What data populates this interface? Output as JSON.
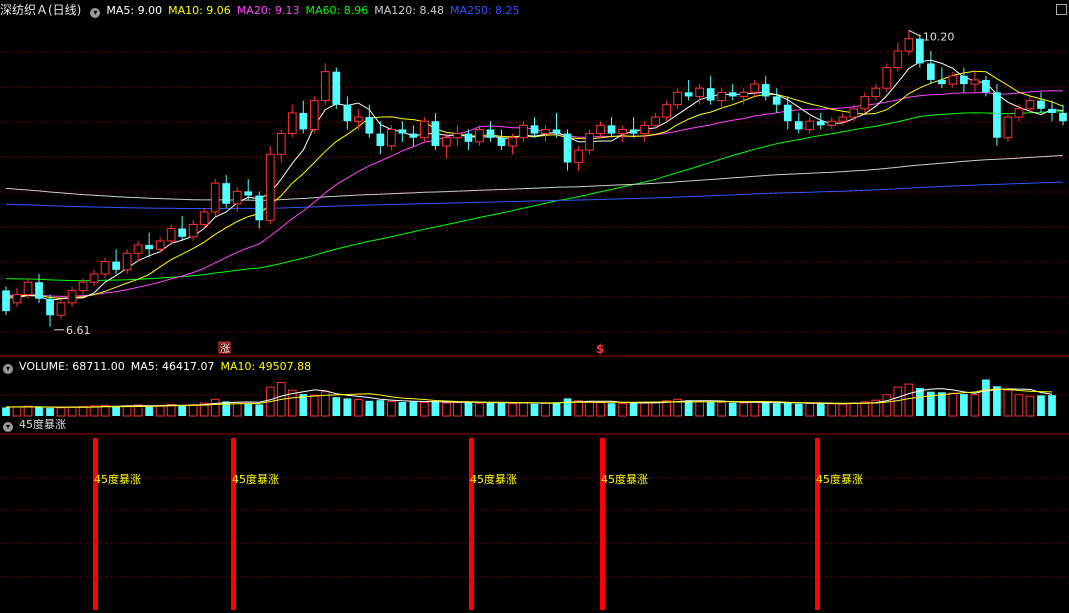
{
  "header": {
    "title": "深纺织Ａ(日线)",
    "indicators": [
      {
        "text": "MA5: 9.00",
        "color": "#ffffff"
      },
      {
        "text": "MA10: 9.06",
        "color": "#ffff00"
      },
      {
        "text": "MA20: 9.13",
        "color": "#ff44ff"
      },
      {
        "text": "MA60: 8.96",
        "color": "#00ff00"
      },
      {
        "text": "MA120: 8.48",
        "color": "#cccccc"
      },
      {
        "text": "MA250: 8.25",
        "color": "#3355ff"
      }
    ]
  },
  "volume_header": {
    "volume": "VOLUME: 68711.00",
    "ma5": "MA5: 46417.07",
    "ma10": "MA10: 49507.88"
  },
  "signal_header": {
    "title": "45度暴涨"
  },
  "annotations": {
    "high_label": "10.20",
    "low_label": "6.61",
    "marker_1": "涨",
    "marker_2": "$"
  },
  "colors": {
    "up": "#ff3232",
    "down": "#54ffff",
    "grid": "#7a0000",
    "ma5": "#ffffff",
    "ma10": "#ffff00",
    "ma20": "#ff44ff",
    "ma60": "#00ff00",
    "ma120": "#cccccc",
    "ma250": "#3355ff",
    "signal": "#ff0000"
  },
  "chart_data": [
    {
      "type": "candlestick",
      "candles": [
        [
          7.05,
          7.1,
          6.8,
          6.75
        ],
        [
          6.9,
          7.08,
          7.0,
          6.85
        ],
        [
          7.0,
          7.2,
          7.15,
          6.95
        ],
        [
          7.15,
          7.25,
          6.95,
          6.9
        ],
        [
          6.95,
          7.0,
          6.75,
          6.61
        ],
        [
          6.75,
          6.95,
          6.9,
          6.7
        ],
        [
          6.9,
          7.1,
          7.05,
          6.85
        ],
        [
          7.05,
          7.2,
          7.15,
          7.0
        ],
        [
          7.15,
          7.3,
          7.25,
          7.1
        ],
        [
          7.25,
          7.45,
          7.4,
          7.2
        ],
        [
          7.4,
          7.55,
          7.3,
          7.25
        ],
        [
          7.3,
          7.55,
          7.5,
          7.25
        ],
        [
          7.5,
          7.65,
          7.6,
          7.4
        ],
        [
          7.6,
          7.75,
          7.55,
          7.45
        ],
        [
          7.55,
          7.7,
          7.65,
          7.5
        ],
        [
          7.65,
          7.85,
          7.8,
          7.6
        ],
        [
          7.8,
          7.95,
          7.7,
          7.65
        ],
        [
          7.7,
          7.9,
          7.85,
          7.65
        ],
        [
          7.85,
          8.05,
          8.0,
          7.8
        ],
        [
          8.0,
          8.4,
          8.35,
          7.95
        ],
        [
          8.35,
          8.45,
          8.1,
          8.05
        ],
        [
          8.1,
          8.3,
          8.25,
          8.0
        ],
        [
          8.25,
          8.4,
          8.2,
          8.15
        ],
        [
          8.2,
          8.25,
          7.9,
          7.8
        ],
        [
          7.9,
          8.8,
          8.7,
          7.85
        ],
        [
          8.7,
          9.0,
          8.95,
          8.6
        ],
        [
          8.95,
          9.3,
          9.2,
          8.9
        ],
        [
          9.2,
          9.35,
          9.0,
          8.95
        ],
        [
          9.0,
          9.4,
          9.35,
          8.95
        ],
        [
          9.35,
          9.8,
          9.7,
          9.3
        ],
        [
          9.7,
          9.75,
          9.3,
          9.25
        ],
        [
          9.3,
          9.4,
          9.1,
          9.0
        ],
        [
          9.1,
          9.25,
          9.15,
          9.0
        ],
        [
          9.15,
          9.3,
          8.95,
          8.9
        ],
        [
          8.95,
          9.1,
          8.8,
          8.7
        ],
        [
          8.8,
          9.05,
          9.0,
          8.75
        ],
        [
          9.0,
          9.1,
          8.95,
          8.85
        ],
        [
          8.95,
          9.05,
          8.9,
          8.8
        ],
        [
          8.9,
          9.15,
          9.1,
          8.85
        ],
        [
          9.1,
          9.2,
          8.8,
          8.75
        ],
        [
          8.8,
          8.95,
          8.9,
          8.65
        ],
        [
          8.9,
          9.05,
          8.95,
          8.8
        ],
        [
          8.95,
          9.0,
          8.85,
          8.75
        ],
        [
          8.85,
          9.05,
          9.0,
          8.8
        ],
        [
          9.0,
          9.1,
          8.9,
          8.85
        ],
        [
          8.9,
          9.0,
          8.8,
          8.75
        ],
        [
          8.8,
          8.95,
          8.9,
          8.7
        ],
        [
          8.9,
          9.1,
          9.05,
          8.85
        ],
        [
          9.05,
          9.15,
          8.95,
          8.9
        ],
        [
          8.95,
          9.05,
          9.0,
          8.85
        ],
        [
          9.0,
          9.2,
          8.95,
          8.9
        ],
        [
          8.95,
          9.0,
          8.6,
          8.5
        ],
        [
          8.6,
          8.8,
          8.75,
          8.5
        ],
        [
          8.75,
          9.0,
          8.95,
          8.7
        ],
        [
          8.95,
          9.1,
          9.05,
          8.9
        ],
        [
          9.05,
          9.15,
          8.95,
          8.9
        ],
        [
          8.95,
          9.05,
          9.0,
          8.85
        ],
        [
          9.0,
          9.15,
          8.95,
          8.9
        ],
        [
          8.95,
          9.1,
          9.05,
          8.85
        ],
        [
          9.05,
          9.2,
          9.15,
          9.0
        ],
        [
          9.15,
          9.35,
          9.3,
          9.1
        ],
        [
          9.3,
          9.5,
          9.45,
          9.25
        ],
        [
          9.45,
          9.6,
          9.4,
          9.35
        ],
        [
          9.4,
          9.55,
          9.5,
          9.3
        ],
        [
          9.5,
          9.65,
          9.35,
          9.3
        ],
        [
          9.35,
          9.5,
          9.45,
          9.25
        ],
        [
          9.45,
          9.55,
          9.4,
          9.35
        ],
        [
          9.4,
          9.5,
          9.45,
          9.3
        ],
        [
          9.45,
          9.6,
          9.55,
          9.4
        ],
        [
          9.55,
          9.65,
          9.4,
          9.35
        ],
        [
          9.4,
          9.5,
          9.3,
          9.2
        ],
        [
          9.3,
          9.4,
          9.1,
          9.0
        ],
        [
          9.1,
          9.2,
          9.0,
          8.95
        ],
        [
          9.0,
          9.15,
          9.1,
          8.95
        ],
        [
          9.1,
          9.2,
          9.05,
          9.0
        ],
        [
          9.05,
          9.15,
          9.1,
          9.0
        ],
        [
          9.1,
          9.2,
          9.15,
          9.05
        ],
        [
          9.15,
          9.3,
          9.25,
          9.1
        ],
        [
          9.25,
          9.45,
          9.4,
          9.2
        ],
        [
          9.4,
          9.55,
          9.5,
          9.35
        ],
        [
          9.5,
          9.8,
          9.75,
          9.45
        ],
        [
          9.75,
          10.05,
          9.95,
          9.7
        ],
        [
          9.95,
          10.2,
          10.1,
          9.9
        ],
        [
          10.1,
          10.15,
          9.8,
          9.75
        ],
        [
          9.8,
          9.95,
          9.6,
          9.55
        ],
        [
          9.6,
          9.75,
          9.55,
          9.5
        ],
        [
          9.55,
          9.7,
          9.65,
          9.5
        ],
        [
          9.65,
          9.75,
          9.55,
          9.45
        ],
        [
          9.55,
          9.7,
          9.6,
          9.45
        ],
        [
          9.6,
          9.65,
          9.45,
          9.4
        ],
        [
          9.45,
          9.55,
          8.9,
          8.8
        ],
        [
          8.9,
          9.2,
          9.15,
          8.85
        ],
        [
          9.15,
          9.3,
          9.25,
          9.1
        ],
        [
          9.25,
          9.4,
          9.35,
          9.2
        ],
        [
          9.35,
          9.45,
          9.25,
          9.2
        ],
        [
          9.25,
          9.35,
          9.2,
          9.1
        ],
        [
          9.2,
          9.3,
          9.1,
          9.05
        ]
      ]
    },
    {
      "type": "bar",
      "values": [
        28000,
        30000,
        32000,
        29000,
        26000,
        27000,
        30000,
        31000,
        33000,
        35000,
        32000,
        34000,
        36000,
        33000,
        35000,
        38000,
        36000,
        37000,
        42000,
        55000,
        48000,
        45000,
        40000,
        38000,
        95000,
        110000,
        85000,
        72000,
        68000,
        80000,
        62000,
        58000,
        54000,
        50000,
        52000,
        48000,
        46000,
        47000,
        45000,
        49000,
        43000,
        44000,
        46000,
        42000,
        45000,
        43000,
        41000,
        44000,
        40000,
        42000,
        45000,
        58000,
        50000,
        47000,
        44000,
        42000,
        41000,
        43000,
        44000,
        46000,
        50000,
        55000,
        52000,
        48000,
        47000,
        45000,
        44000,
        43000,
        46000,
        44000,
        42000,
        43000,
        40000,
        41000,
        42000,
        40000,
        39000,
        43000,
        46000,
        52000,
        70000,
        95000,
        105000,
        92000,
        80000,
        78000,
        75000,
        72000,
        70000,
        120000,
        98000,
        85000,
        70000,
        65000,
        68000,
        68711
      ]
    }
  ],
  "signals": [
    {
      "label": "45度暴涨"
    },
    {
      "label": "45度暴涨"
    },
    {
      "label": "45度暴涨"
    },
    {
      "label": "45度暴涨"
    },
    {
      "label": "45度暴涨"
    }
  ]
}
